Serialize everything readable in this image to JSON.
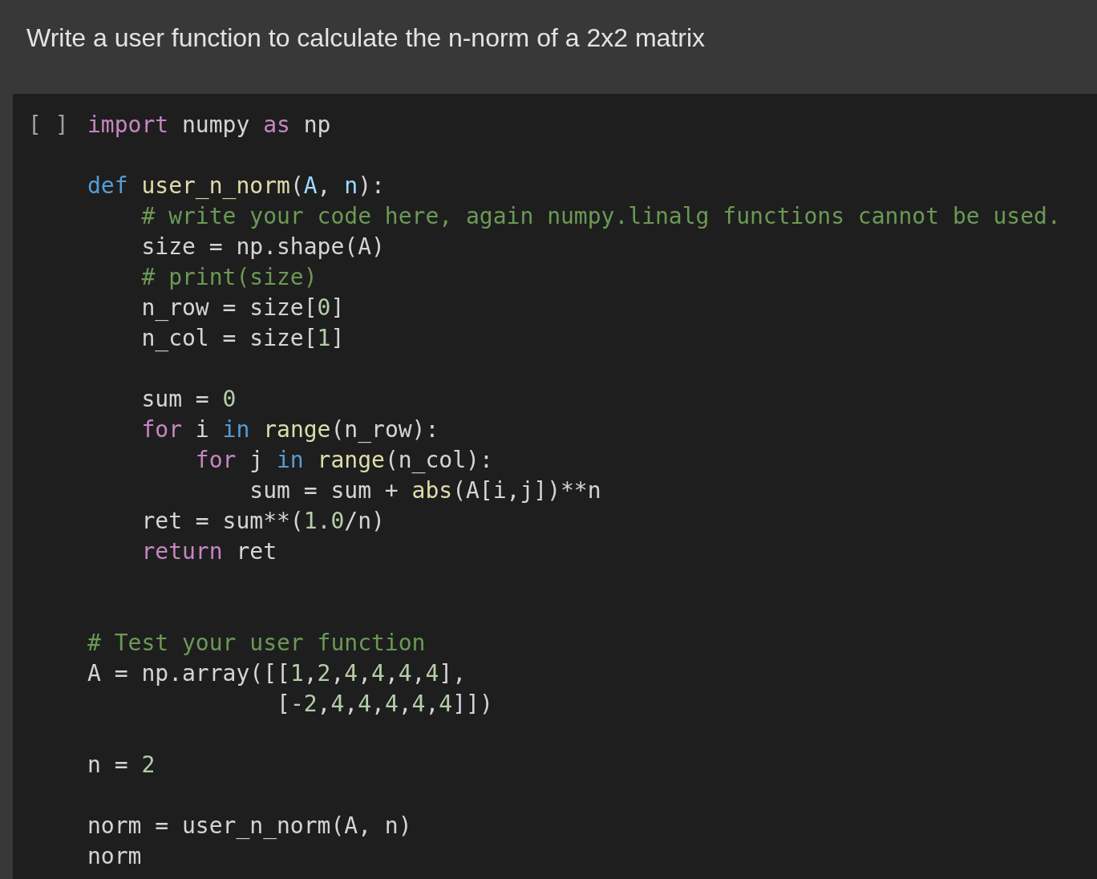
{
  "heading": {
    "text": "Write a user function to calculate the n-norm of a 2x2 matrix"
  },
  "cell": {
    "run_marker": "[ ]",
    "lines": [
      {
        "kind": "code",
        "tokens": [
          {
            "text": "import",
            "kind": "keyword"
          },
          {
            "text": " numpy ",
            "kind": "plain"
          },
          {
            "text": "as",
            "kind": "keyword"
          },
          {
            "text": " np",
            "kind": "plain"
          }
        ]
      },
      {
        "kind": "blank"
      },
      {
        "kind": "code",
        "tokens": [
          {
            "text": "def ",
            "kind": "storage"
          },
          {
            "text": "user_n_norm",
            "kind": "function"
          },
          {
            "text": "(",
            "kind": "plain"
          },
          {
            "text": "A",
            "kind": "param"
          },
          {
            "text": ", ",
            "kind": "plain"
          },
          {
            "text": "n",
            "kind": "param"
          },
          {
            "text": "):",
            "kind": "plain"
          }
        ]
      },
      {
        "kind": "code",
        "tokens": [
          {
            "text": "    # write your code here, again numpy.linalg functions cannot be used.",
            "kind": "comment"
          }
        ]
      },
      {
        "kind": "code",
        "tokens": [
          {
            "text": "    size = np.shape(A)",
            "kind": "plain"
          }
        ]
      },
      {
        "kind": "code",
        "tokens": [
          {
            "text": "    # print(size)",
            "kind": "comment"
          }
        ]
      },
      {
        "kind": "code",
        "tokens": [
          {
            "text": "    n_row = size[",
            "kind": "plain"
          },
          {
            "text": "0",
            "kind": "number"
          },
          {
            "text": "]",
            "kind": "plain"
          }
        ]
      },
      {
        "kind": "code",
        "tokens": [
          {
            "text": "    n_col = size[",
            "kind": "plain"
          },
          {
            "text": "1",
            "kind": "number"
          },
          {
            "text": "]",
            "kind": "plain"
          }
        ]
      },
      {
        "kind": "blank"
      },
      {
        "kind": "code",
        "tokens": [
          {
            "text": "    sum = ",
            "kind": "plain"
          },
          {
            "text": "0",
            "kind": "number"
          }
        ]
      },
      {
        "kind": "code",
        "tokens": [
          {
            "text": "    for",
            "kind": "keyword"
          },
          {
            "text": " i ",
            "kind": "plain"
          },
          {
            "text": "in ",
            "kind": "storage"
          },
          {
            "text": "range",
            "kind": "function"
          },
          {
            "text": "(n_row):",
            "kind": "plain"
          }
        ]
      },
      {
        "kind": "code",
        "tokens": [
          {
            "text": "        for",
            "kind": "keyword"
          },
          {
            "text": " j ",
            "kind": "plain"
          },
          {
            "text": "in ",
            "kind": "storage"
          },
          {
            "text": "range",
            "kind": "function"
          },
          {
            "text": "(n_col):",
            "kind": "plain"
          }
        ]
      },
      {
        "kind": "code",
        "tokens": [
          {
            "text": "            sum = sum + ",
            "kind": "plain"
          },
          {
            "text": "abs",
            "kind": "function"
          },
          {
            "text": "(A[i,j])**n",
            "kind": "plain"
          }
        ]
      },
      {
        "kind": "code",
        "tokens": [
          {
            "text": "    ret = sum**(",
            "kind": "plain"
          },
          {
            "text": "1.0",
            "kind": "number"
          },
          {
            "text": "/n)",
            "kind": "plain"
          }
        ]
      },
      {
        "kind": "code",
        "tokens": [
          {
            "text": "    return",
            "kind": "keyword"
          },
          {
            "text": " ret",
            "kind": "plain"
          }
        ]
      },
      {
        "kind": "blank"
      },
      {
        "kind": "blank"
      },
      {
        "kind": "code",
        "tokens": [
          {
            "text": "# Test your user function",
            "kind": "comment"
          }
        ]
      },
      {
        "kind": "code",
        "tokens": [
          {
            "text": "A = np.array([[",
            "kind": "plain"
          },
          {
            "text": "1",
            "kind": "number"
          },
          {
            "text": ",",
            "kind": "plain"
          },
          {
            "text": "2",
            "kind": "number"
          },
          {
            "text": ",",
            "kind": "plain"
          },
          {
            "text": "4",
            "kind": "number"
          },
          {
            "text": ",",
            "kind": "plain"
          },
          {
            "text": "4",
            "kind": "number"
          },
          {
            "text": ",",
            "kind": "plain"
          },
          {
            "text": "4",
            "kind": "number"
          },
          {
            "text": ",",
            "kind": "plain"
          },
          {
            "text": "4",
            "kind": "number"
          },
          {
            "text": "],",
            "kind": "plain"
          }
        ]
      },
      {
        "kind": "code",
        "tokens": [
          {
            "text": "              [",
            "kind": "plain"
          },
          {
            "text": "-2",
            "kind": "number"
          },
          {
            "text": ",",
            "kind": "plain"
          },
          {
            "text": "4",
            "kind": "number"
          },
          {
            "text": ",",
            "kind": "plain"
          },
          {
            "text": "4",
            "kind": "number"
          },
          {
            "text": ",",
            "kind": "plain"
          },
          {
            "text": "4",
            "kind": "number"
          },
          {
            "text": ",",
            "kind": "plain"
          },
          {
            "text": "4",
            "kind": "number"
          },
          {
            "text": ",",
            "kind": "plain"
          },
          {
            "text": "4",
            "kind": "number"
          },
          {
            "text": "]])",
            "kind": "plain"
          }
        ]
      },
      {
        "kind": "blank"
      },
      {
        "kind": "code",
        "tokens": [
          {
            "text": "n = ",
            "kind": "plain"
          },
          {
            "text": "2",
            "kind": "number"
          }
        ]
      },
      {
        "kind": "blank"
      },
      {
        "kind": "code",
        "tokens": [
          {
            "text": "norm = user_n_norm(A, n)",
            "kind": "plain"
          }
        ]
      },
      {
        "kind": "code",
        "tokens": [
          {
            "text": "norm",
            "kind": "plain"
          }
        ]
      }
    ]
  }
}
